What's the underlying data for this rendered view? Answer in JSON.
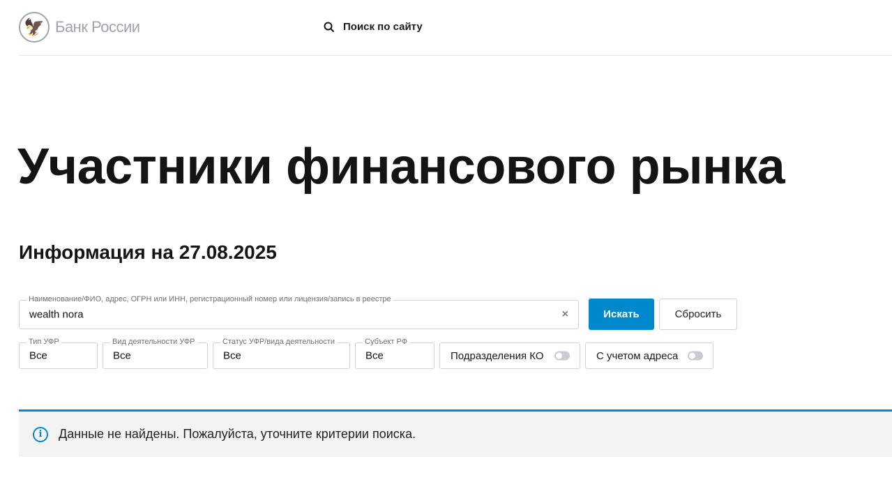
{
  "header": {
    "logo_text": "Банк России",
    "search_label": "Поиск по сайту"
  },
  "page_title": "Участники финансового рынка",
  "info_date": "Информация на 27.08.2025",
  "search": {
    "label": "Наименование/ФИО, адрес, ОГРН или ИНН, регистрационный номер или лицензия/запись в реестре",
    "value": "wealth nora",
    "clear": "×",
    "submit": "Искать",
    "reset": "Сбросить"
  },
  "filters": [
    {
      "label": "Тип УФР",
      "value": "Все"
    },
    {
      "label": "Вид деятельности УФР",
      "value": "Все"
    },
    {
      "label": "Статус УФР/вида деятельности",
      "value": "Все"
    },
    {
      "label": "Субъект РФ",
      "value": "Все"
    }
  ],
  "toggles": [
    {
      "label": "Подразделения КО",
      "on": false
    },
    {
      "label": "С учетом адреса",
      "on": false
    }
  ],
  "message": {
    "icon": "i",
    "text": "Данные не найдены. Пожалуйста, уточните критерии поиска."
  },
  "colors": {
    "accent": "#0088cc",
    "logo": "#9ea3ad"
  }
}
